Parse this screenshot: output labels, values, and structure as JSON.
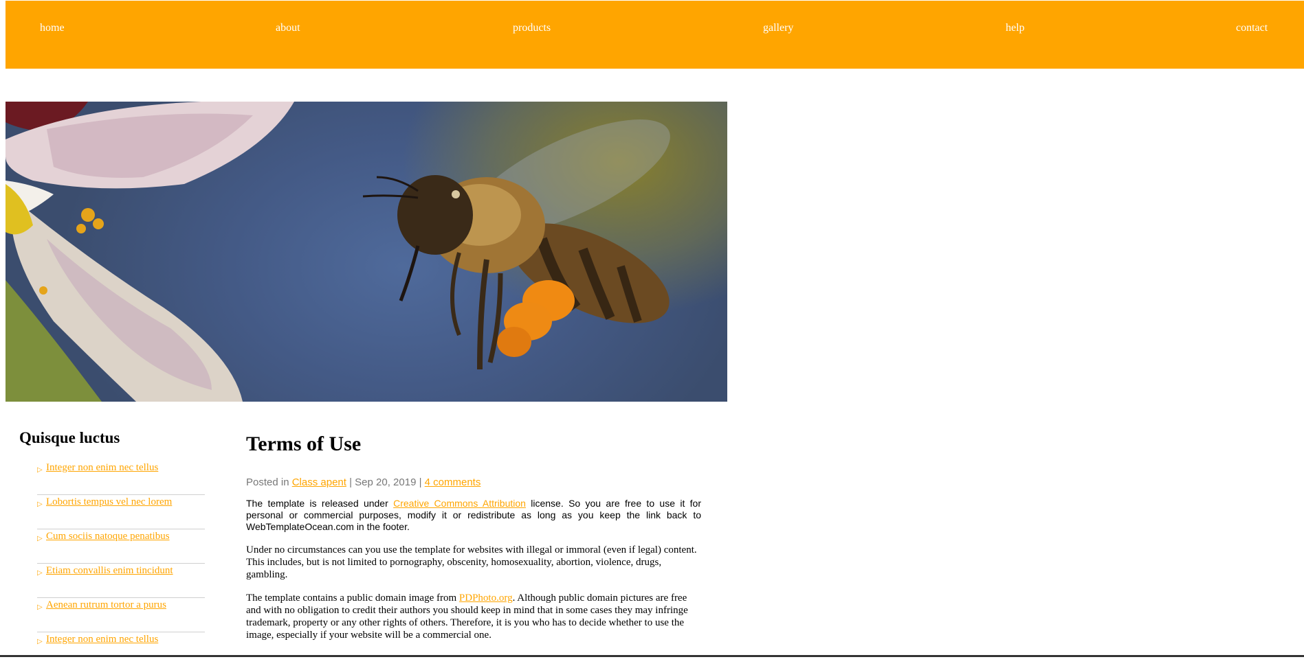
{
  "nav": {
    "items": [
      "home",
      "about",
      "products",
      "gallery",
      "help",
      "contact"
    ]
  },
  "hero": {
    "alt": "bee-photo"
  },
  "sidebar": {
    "title": "Quisque luctus",
    "links": [
      "Integer non enim nec tellus",
      "Lobortis tempus vel nec lorem",
      "Cum sociis natoque penatibus",
      "Etiam convallis enim tincidunt",
      "Aenean rutrum tortor a purus",
      "Integer non enim nec tellus"
    ]
  },
  "article": {
    "title": "Terms of Use",
    "meta": {
      "posted_in": "Posted in ",
      "category": "Class apent",
      "sep1": " | Sep 20, 2019 | ",
      "comments": "4 comments"
    },
    "p1": {
      "before": "The template is released under ",
      "link": "Creative Commons Attribution",
      "after": " license. So you are free to use it for personal or commercial purposes, modify it or redistribute as long as you keep the link back to WebTemplateOcean.com in the footer."
    },
    "p2": "Under no circumstances can you use the template for websites with illegal or immoral (even if legal) content. This includes, but is not limited to pornography, obscenity, homosexuality, abortion, violence, drugs, gambling.",
    "p3": {
      "before": "The template contains a public domain image from ",
      "link": "PDPhoto.org",
      "after": ". Although public domain pictures are free and with no obligation to credit their authors you should keep in mind that in some cases they may infringe trademark, property or any other rights of others. Therefore, it is you who has to decide whether to use the image, especially if your website will be a commercial one."
    }
  },
  "colors": {
    "accent": "#ffa500",
    "meta_text": "#777777"
  }
}
